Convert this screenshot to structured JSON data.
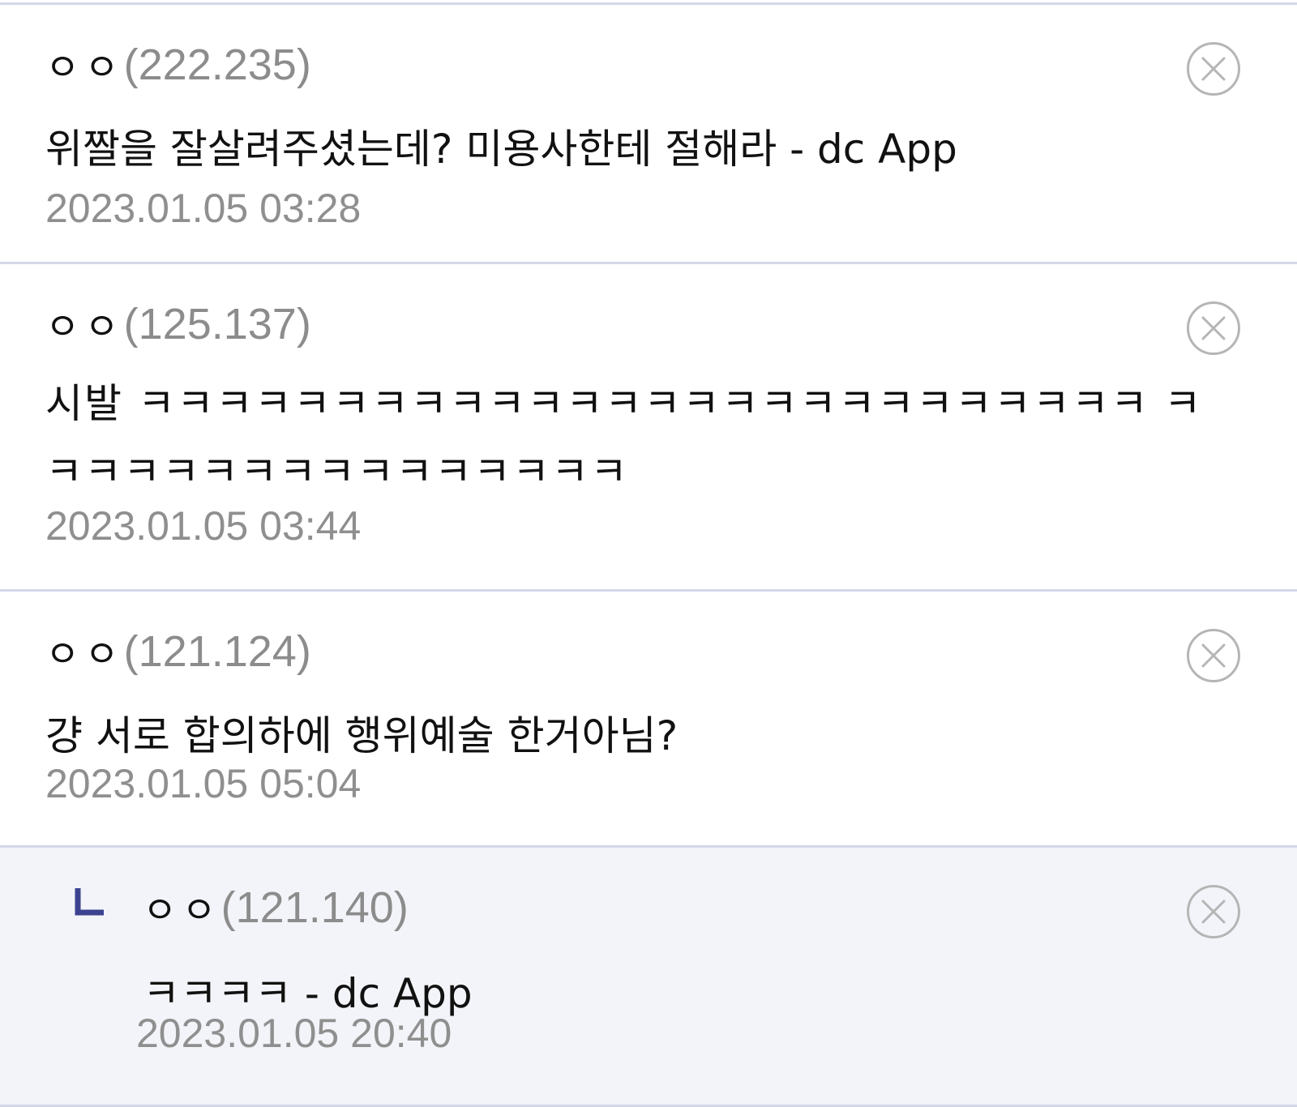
{
  "comments": [
    {
      "nickname": "ㅇㅇ",
      "ip": "(222.235)",
      "text": "위짤을 잘살려주셨는데? 미용사한테 절해라 - dc App",
      "date": "2023.01.05 03:28",
      "is_reply": false
    },
    {
      "nickname": "ㅇㅇ",
      "ip": "(125.137)",
      "text": "시발 ㅋㅋㅋㅋㅋㅋㅋㅋㅋㅋㅋㅋㅋㅋㅋㅋㅋㅋㅋㅋㅋㅋㅋㅋㅋㅋ ㅋㅋㅋㅋㅋㅋㅋㅋㅋㅋㅋㅋㅋㅋㅋㅋ",
      "date": "2023.01.05 03:44",
      "is_reply": false
    },
    {
      "nickname": "ㅇㅇ",
      "ip": "(121.124)",
      "text": "걍 서로 합의하에 행위예술 한거아님?",
      "date": "2023.01.05 05:04",
      "is_reply": false
    },
    {
      "nickname": "ㅇㅇ",
      "ip": "(121.140)",
      "text": "ㅋㅋㅋㅋ - dc App",
      "date": "2023.01.05 20:40",
      "is_reply": true
    }
  ],
  "icons": {
    "delete": "close-circle-icon",
    "reply_marker": "reply-arrow-icon"
  },
  "colors": {
    "reply_marker": "#3b4390",
    "divider": "#d4d7e6",
    "reply_background": "#f3f4f9",
    "meta_text": "#8f8f8f"
  }
}
